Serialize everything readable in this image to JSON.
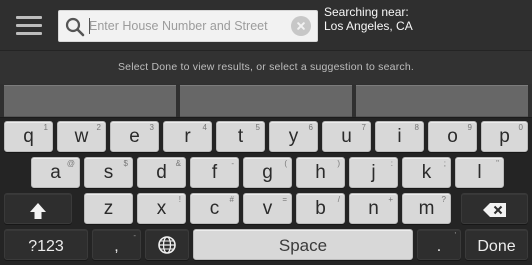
{
  "header": {
    "menu_icon": "hamburger-menu-icon",
    "search": {
      "value": "",
      "placeholder": "Enter House Number and Street",
      "search_icon": "search-icon",
      "clear_icon": "clear-icon"
    },
    "searching_near": {
      "label": "Searching near:",
      "place": "Los Angeles, CA"
    }
  },
  "hint": {
    "text": "Select Done to view results, or select a suggestion to search."
  },
  "suggestions": {
    "slots": [
      "",
      "",
      ""
    ]
  },
  "keyboard": {
    "row1": [
      {
        "label": "q",
        "sup": "1"
      },
      {
        "label": "w",
        "sup": "2"
      },
      {
        "label": "e",
        "sup": "3"
      },
      {
        "label": "r",
        "sup": "4"
      },
      {
        "label": "t",
        "sup": "5"
      },
      {
        "label": "y",
        "sup": "6"
      },
      {
        "label": "u",
        "sup": "7"
      },
      {
        "label": "i",
        "sup": "8"
      },
      {
        "label": "o",
        "sup": "9"
      },
      {
        "label": "p",
        "sup": "0"
      }
    ],
    "row2": [
      {
        "label": "a",
        "sup": "@"
      },
      {
        "label": "s",
        "sup": "$"
      },
      {
        "label": "d",
        "sup": "&"
      },
      {
        "label": "f",
        "sup": "-"
      },
      {
        "label": "g",
        "sup": "("
      },
      {
        "label": "h",
        "sup": ")"
      },
      {
        "label": "j",
        "sup": ":"
      },
      {
        "label": "k",
        "sup": ";"
      },
      {
        "label": "l",
        "sup": "\""
      }
    ],
    "row3": [
      {
        "label": "z",
        "sup": ""
      },
      {
        "label": "x",
        "sup": "!"
      },
      {
        "label": "c",
        "sup": "#"
      },
      {
        "label": "v",
        "sup": "="
      },
      {
        "label": "b",
        "sup": "/"
      },
      {
        "label": "n",
        "sup": "+"
      },
      {
        "label": "m",
        "sup": "?"
      }
    ],
    "row4": {
      "symbols": "?123",
      "comma": ",",
      "comma_sup": "-",
      "globe_icon": "globe-icon",
      "space": "Space",
      "period": ".",
      "period_sup": "'",
      "done": "Done"
    },
    "shift_icon": "shift-icon",
    "backspace_icon": "backspace-icon"
  },
  "colors": {
    "background": "#303030",
    "key_light": "#d8d8d8",
    "key_dark": "#2e2e2e",
    "suggestion_bar": "#676767",
    "header_text": "#f7f7f7",
    "hint_text": "#bdbdbd",
    "search_box": "#f2f2f2"
  }
}
